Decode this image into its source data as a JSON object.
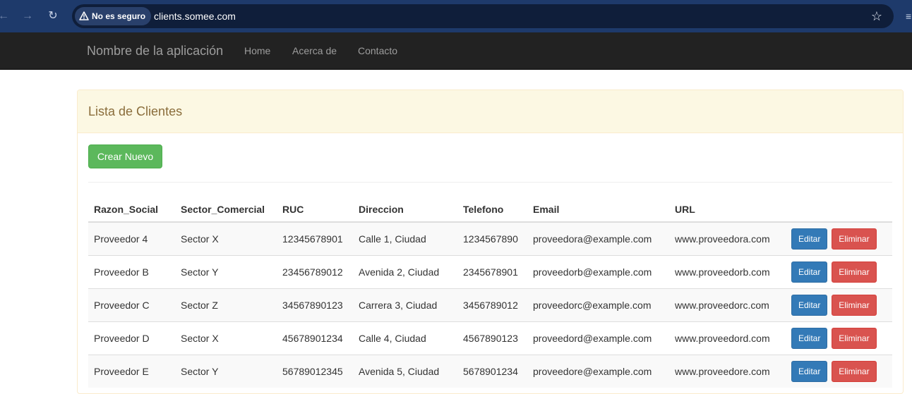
{
  "browser": {
    "security_label": "No es seguro",
    "url": "clients.somee.com",
    "icons": [
      "back-arrow-icon",
      "forward-arrow-icon",
      "reload-icon",
      "warning-icon",
      "star-icon",
      "menu-icon"
    ]
  },
  "navbar": {
    "brand": "Nombre de la aplicación",
    "links": [
      "Home",
      "Acerca de",
      "Contacto"
    ]
  },
  "panel": {
    "title": "Lista de Clientes",
    "create_label": "Crear Nuevo"
  },
  "table": {
    "headers": [
      "Razon_Social",
      "Sector_Comercial",
      "RUC",
      "Direccion",
      "Telefono",
      "Email",
      "URL"
    ],
    "rows": [
      [
        "Proveedor 4",
        "Sector X",
        "12345678901",
        "Calle 1, Ciudad",
        "1234567890",
        "proveedora@example.com",
        "www.proveedora.com"
      ],
      [
        "Proveedor B",
        "Sector Y",
        "23456789012",
        "Avenida 2, Ciudad",
        "2345678901",
        "proveedorb@example.com",
        "www.proveedorb.com"
      ],
      [
        "Proveedor C",
        "Sector Z",
        "34567890123",
        "Carrera 3, Ciudad",
        "3456789012",
        "proveedorc@example.com",
        "www.proveedorc.com"
      ],
      [
        "Proveedor D",
        "Sector X",
        "45678901234",
        "Calle 4, Ciudad",
        "4567890123",
        "proveedord@example.com",
        "www.proveedord.com"
      ],
      [
        "Proveedor E",
        "Sector Y",
        "56789012345",
        "Avenida 5, Ciudad",
        "5678901234",
        "proveedore@example.com",
        "www.proveedore.com"
      ]
    ],
    "edit_label": "Editar",
    "delete_label": "Eliminar"
  },
  "colors": {
    "navbar_bg": "#222222",
    "panel_heading_bg": "#fcf8e3",
    "success": "#5cb85c",
    "primary": "#337ab7",
    "danger": "#d9534f"
  }
}
